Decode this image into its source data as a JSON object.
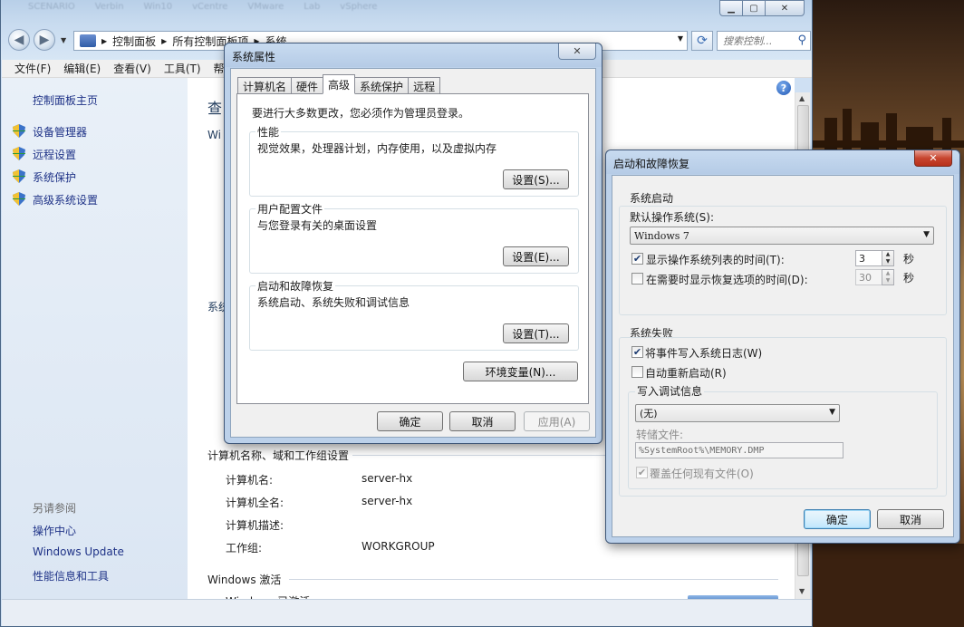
{
  "ghost_tabs": [
    "SCENARIO",
    "Verbin",
    "Win10",
    "vCentre",
    "VMware",
    "Lab",
    "vSphere"
  ],
  "main": {
    "address": [
      "控制面板",
      "所有控制面板项",
      "系统"
    ],
    "search_placeholder": "搜索控制...",
    "menu": [
      "文件(F)",
      "编辑(E)",
      "查看(V)",
      "工具(T)",
      "帮"
    ],
    "sidebar": {
      "home": "控制面板主页",
      "links": [
        "设备管理器",
        "远程设置",
        "系统保护",
        "高级系统设置"
      ],
      "see_also_title": "另请参阅",
      "see_also": [
        "操作中心",
        "Windows Update",
        "性能信息和工具"
      ]
    },
    "content": {
      "title_fragment": "查",
      "win_fragment": "Wi",
      "sys_fragment": "系统",
      "computer_section": "计算机名称、域和工作组设置",
      "rows": [
        {
          "label": "计算机名:",
          "value": "server-hx"
        },
        {
          "label": "计算机全名:",
          "value": "server-hx"
        },
        {
          "label": "计算机描述:",
          "value": ""
        },
        {
          "label": "工作组:",
          "value": "WORKGROUP"
        }
      ],
      "activation_section": "Windows 激活",
      "activation_fragment": "Windows 已激活"
    }
  },
  "sysprop": {
    "title": "系统属性",
    "tabs": [
      "计算机名",
      "硬件",
      "高级",
      "系统保护",
      "远程"
    ],
    "active_tab": 2,
    "admin_note": "要进行大多数更改，您必须作为管理员登录。",
    "groups": [
      {
        "title": "性能",
        "desc": "视觉效果，处理器计划，内存使用，以及虚拟内存",
        "button": "设置(S)..."
      },
      {
        "title": "用户配置文件",
        "desc": "与您登录有关的桌面设置",
        "button": "设置(E)..."
      },
      {
        "title": "启动和故障恢复",
        "desc": "系统启动、系统失败和调试信息",
        "button": "设置(T)..."
      }
    ],
    "env_button": "环境变量(N)...",
    "ok": "确定",
    "cancel": "取消",
    "apply": "应用(A)"
  },
  "startup": {
    "title": "启动和故障恢复",
    "startup_group": "系统启动",
    "default_os_label": "默认操作系统(S):",
    "default_os_value": "Windows 7",
    "show_list_label": "显示操作系统列表的时间(T):",
    "show_list_checked": true,
    "show_list_value": "3",
    "show_recovery_label": "在需要时显示恢复选项的时间(D):",
    "show_recovery_checked": false,
    "show_recovery_value": "30",
    "seconds": "秒",
    "failure_group": "系统失败",
    "write_event_label": "将事件写入系统日志(W)",
    "write_event_checked": true,
    "auto_restart_label": "自动重新启动(R)",
    "auto_restart_checked": false,
    "debug_group": "写入调试信息",
    "debug_value": "(无)",
    "dump_label": "转储文件:",
    "dump_value": "%SystemRoot%\\MEMORY.DMP",
    "overwrite_label": "覆盖任何现有文件(O)",
    "overwrite_checked": true,
    "ok": "确定",
    "cancel": "取消"
  }
}
